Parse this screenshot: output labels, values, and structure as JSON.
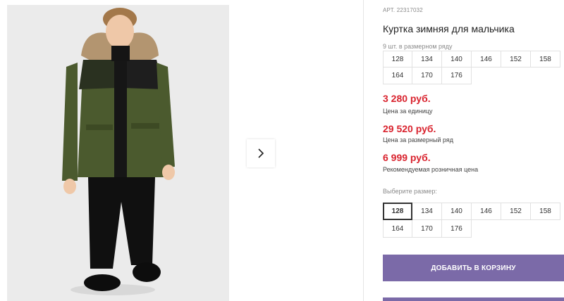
{
  "product": {
    "article": "АРТ. 22317032",
    "title": "Куртка зимняя для мальчика",
    "size_note": "9 шт. в размерном ряду",
    "sizes_row": [
      "128",
      "134",
      "140",
      "146",
      "152",
      "158",
      "164",
      "170",
      "176"
    ]
  },
  "prices": {
    "unit_price": "3 280 руб.",
    "unit_label": "Цена за единицу",
    "row_price": "29 520 руб.",
    "row_label": "Цена за размерный ряд",
    "retail_price": "6 999 руб.",
    "retail_label": "Рекомендуемая розничная цена"
  },
  "size_select": {
    "label": "Выберите размер:",
    "options": [
      "128",
      "134",
      "140",
      "146",
      "152",
      "158",
      "164",
      "170",
      "176"
    ],
    "selected": "128"
  },
  "actions": {
    "add_to_cart": "ДОБАВИТЬ В КОРЗИНУ"
  },
  "colors": {
    "price_red": "#d9232e",
    "button_purple": "#7b6aa8",
    "jacket_green": "#4b5a2e"
  }
}
